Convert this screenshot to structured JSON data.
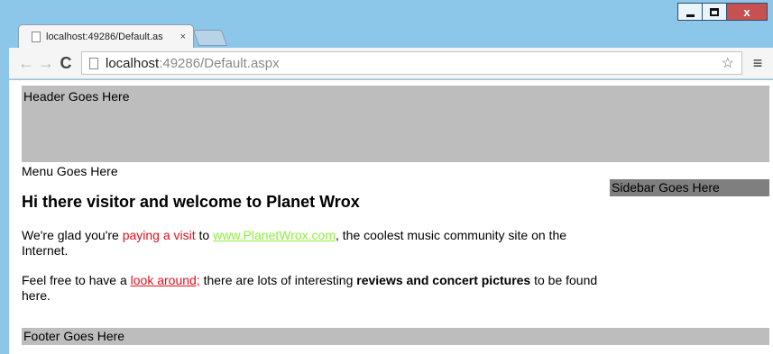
{
  "window": {
    "minimize_icon": "minimize-icon",
    "maximize_icon": "maximize-icon",
    "close_glyph": "x"
  },
  "tab": {
    "title": "localhost:49286/Default.as",
    "close_glyph": "×"
  },
  "toolbar": {
    "back_glyph": "←",
    "forward_glyph": "→",
    "reload_glyph": "C",
    "url_host": "localhost",
    "url_path": ":49286/Default.aspx",
    "star_glyph": "☆",
    "menu_glyph": "≡"
  },
  "page": {
    "header": "Header Goes Here",
    "menu": "Menu Goes Here",
    "sidebar": "Sidebar Goes Here",
    "heading": "Hi there visitor and welcome to Planet Wrox",
    "p1_a": "We're glad you're ",
    "p1_highlight": "paying a visit",
    "p1_b": " to ",
    "p1_link": "www.PlanetWrox.com",
    "p1_c": ", the coolest music community site on the Internet.",
    "p2_a": "Feel free to have a ",
    "p2_link": "look around;",
    "p2_b": " there are lots of interesting ",
    "p2_bold": "reviews and concert pictures",
    "p2_c": " to be found here.",
    "footer": "Footer Goes Here"
  },
  "colors": {
    "window_frame": "#8cc7e9",
    "header_bg": "#bdbdbd",
    "sidebar_bg": "#7f7f7f",
    "highlight": "#e0101d",
    "green_link": "#8cf03a"
  }
}
